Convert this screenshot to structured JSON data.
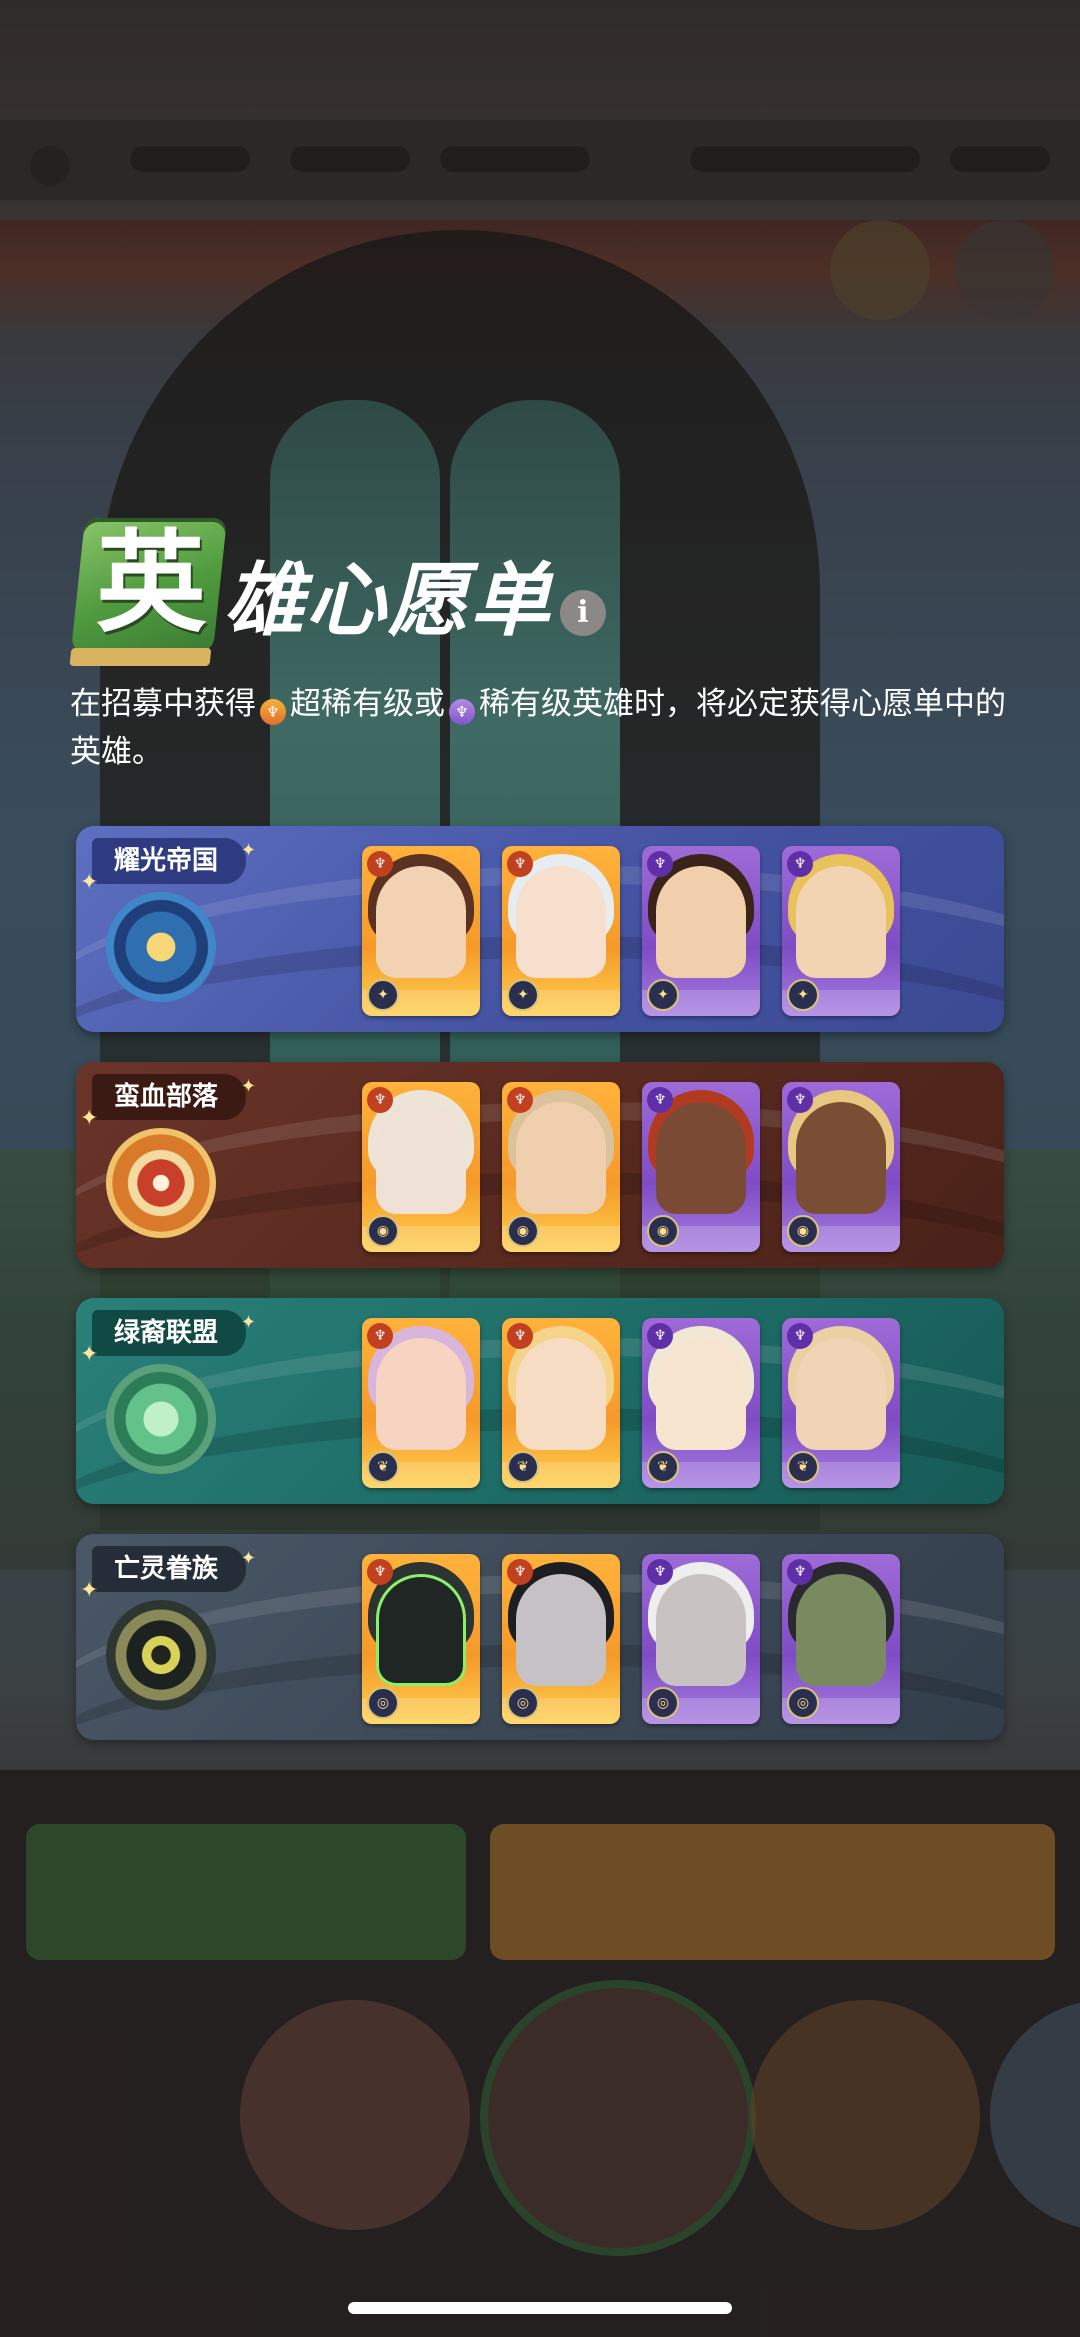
{
  "heading": {
    "title_first_char": "英",
    "title_rest": "雄心愿单",
    "info_icon": "info-icon",
    "desc_part1": "在招募中获得",
    "desc_super": "超稀有级或",
    "desc_rest": "稀有级英雄时，将必定获得心愿单中的英雄。"
  },
  "factions": [
    {
      "name": "耀光帝国",
      "emblem_icon": "four-point-star-icon",
      "panel_color": "#4a5aa0",
      "heroes": [
        {
          "rarity": "super"
        },
        {
          "rarity": "super"
        },
        {
          "rarity": "rare"
        },
        {
          "rarity": "rare"
        }
      ]
    },
    {
      "name": "蛮血部落",
      "emblem_icon": "target-ring-icon",
      "panel_color": "#5a2c24",
      "heroes": [
        {
          "rarity": "super"
        },
        {
          "rarity": "super"
        },
        {
          "rarity": "rare"
        },
        {
          "rarity": "rare"
        }
      ]
    },
    {
      "name": "绿裔联盟",
      "emblem_icon": "leaf-icon",
      "panel_color": "#1d6b66",
      "heroes": [
        {
          "rarity": "super"
        },
        {
          "rarity": "super"
        },
        {
          "rarity": "rare"
        },
        {
          "rarity": "rare"
        }
      ]
    },
    {
      "name": "亡灵眷族",
      "emblem_icon": "eye-icon",
      "panel_color": "#3e4a58",
      "heroes": [
        {
          "rarity": "super"
        },
        {
          "rarity": "super"
        },
        {
          "rarity": "rare"
        },
        {
          "rarity": "rare"
        }
      ]
    }
  ]
}
